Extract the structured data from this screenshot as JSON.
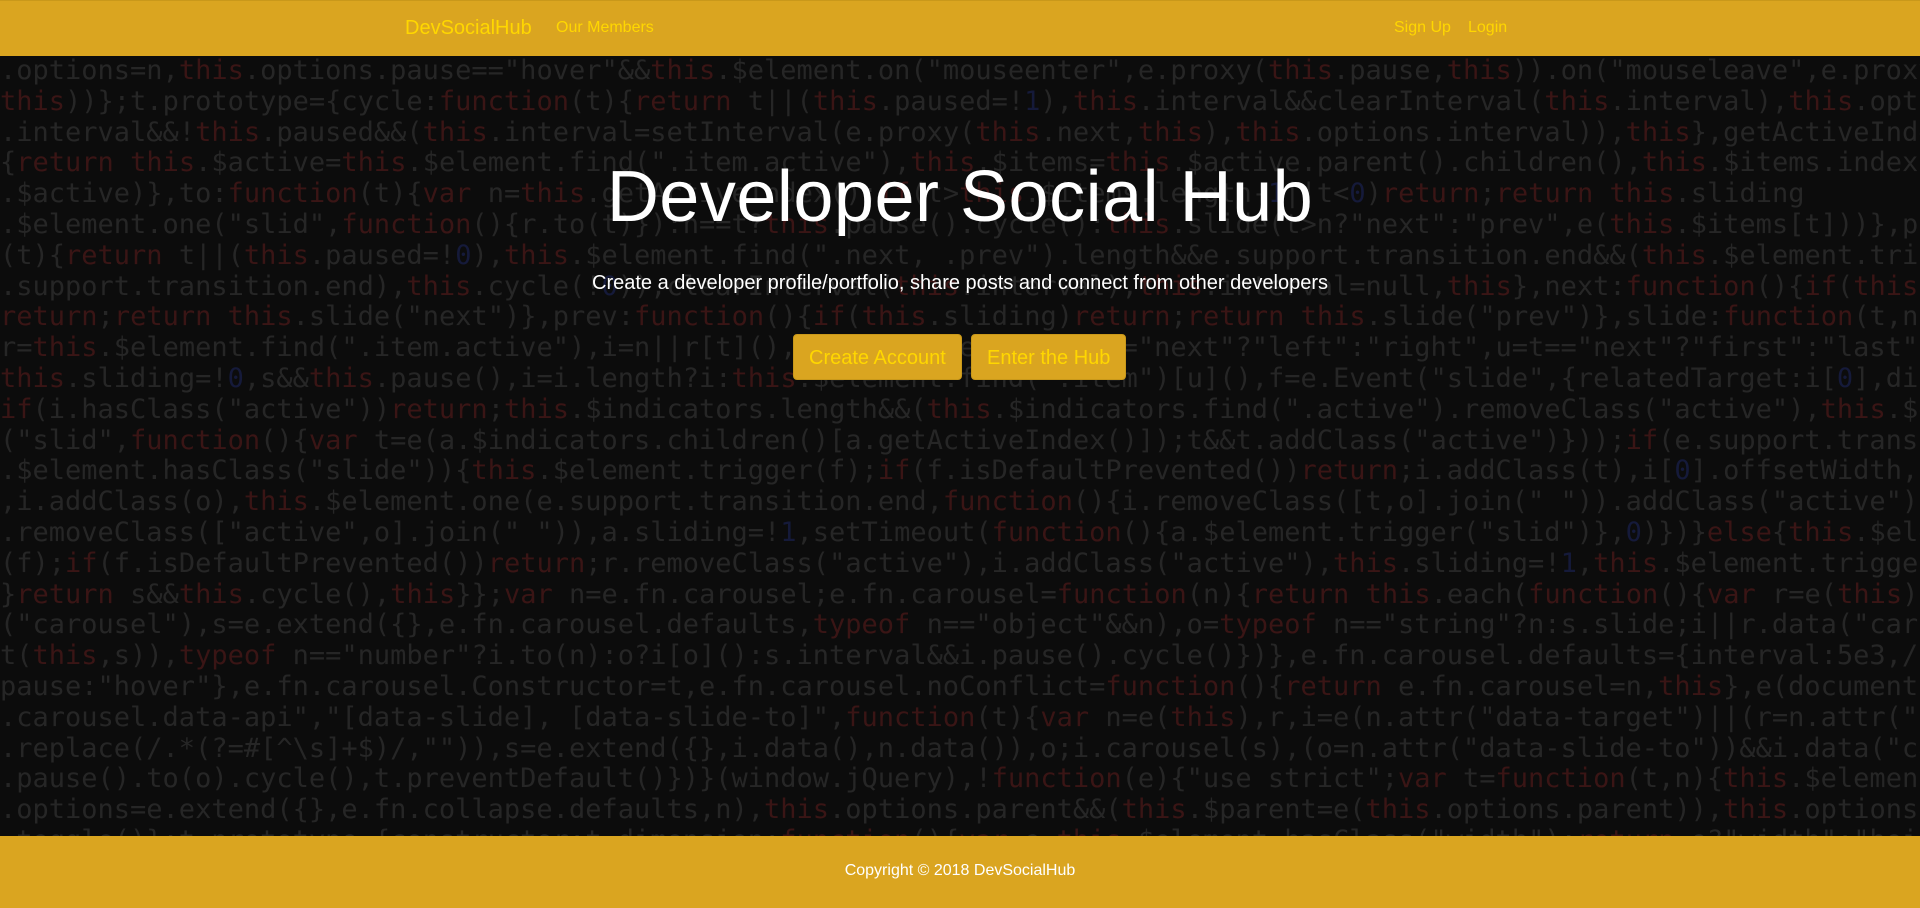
{
  "navbar": {
    "brand": "DevSocialHub",
    "links": {
      "members": "Our Members",
      "signup": "Sign Up",
      "login": "Login"
    }
  },
  "hero": {
    "title": "Developer Social Hub",
    "subtitle": "Create a developer profile/portfolio, share posts and connect from other developers",
    "buttons": {
      "create_account": "Create Account",
      "enter_hub": "Enter the Hub"
    }
  },
  "footer": {
    "copyright": "Copyright © 2018 DevSocialHub"
  },
  "colors": {
    "accent": "#DAA520",
    "link": "#FFD700",
    "background": "#0c0c0c",
    "text": "#ffffff"
  }
}
